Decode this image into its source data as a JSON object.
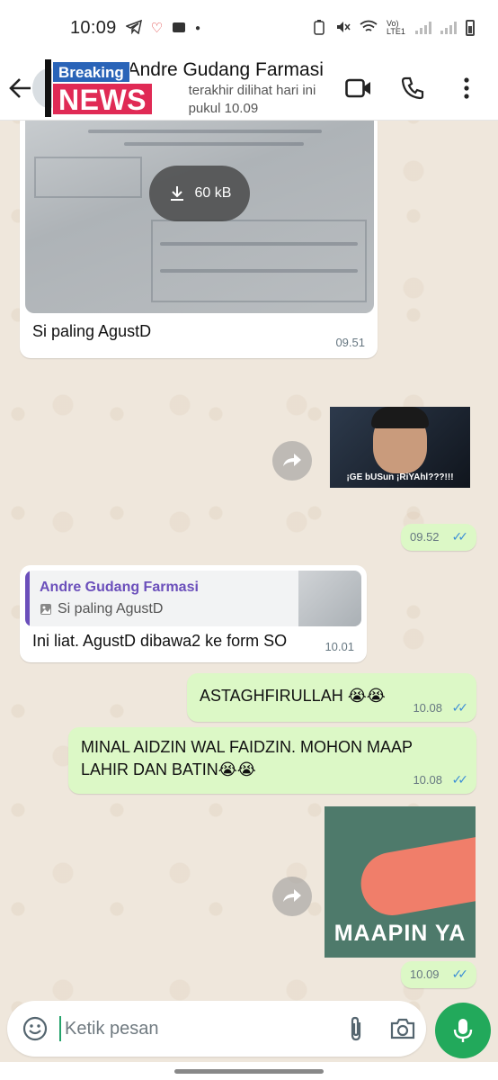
{
  "status_bar": {
    "time": "10:09",
    "network_label": "Vo) LTE1"
  },
  "header": {
    "contact_name": "Andre Gudang Farmasi",
    "last_seen": "terakhir dilihat hari ini pukul 10.09",
    "overlay": {
      "top": "Breaking",
      "bottom": "NEWS"
    }
  },
  "messages": [
    {
      "type": "image",
      "direction": "incoming",
      "download_size": "60 kB",
      "caption": "Si paling AgustD",
      "time": "09.51"
    },
    {
      "type": "sticker",
      "direction": "outgoing",
      "caption": "¡GE bUSun ¡RiYAhl???!!!",
      "time": "09.52"
    },
    {
      "type": "reply",
      "direction": "incoming",
      "quoted_name": "Andre Gudang Farmasi",
      "quoted_text": "Si paling AgustD",
      "text": "Ini liat. AgustD dibawa2 ke form SO",
      "time": "10.01"
    },
    {
      "type": "text",
      "direction": "outgoing",
      "text": "ASTAGHFIRULLAH 😭😭",
      "time": "10.08"
    },
    {
      "type": "text",
      "direction": "outgoing",
      "text": "MINAL AIDZIN WAL FAIDZIN. MOHON MAAP LAHIR DAN BATIN😭😭",
      "time": "10.08"
    },
    {
      "type": "sticker",
      "direction": "outgoing",
      "caption": "MAAPIN YA",
      "time": "10.09"
    }
  ],
  "input": {
    "placeholder": "Ketik pesan"
  },
  "colors": {
    "outgoing_bubble": "#dcf8c6",
    "incoming_bubble": "#ffffff",
    "accent_green": "#22a95b",
    "read_ticks": "#3d8fd6",
    "reply_accent": "#6b4fbb"
  }
}
